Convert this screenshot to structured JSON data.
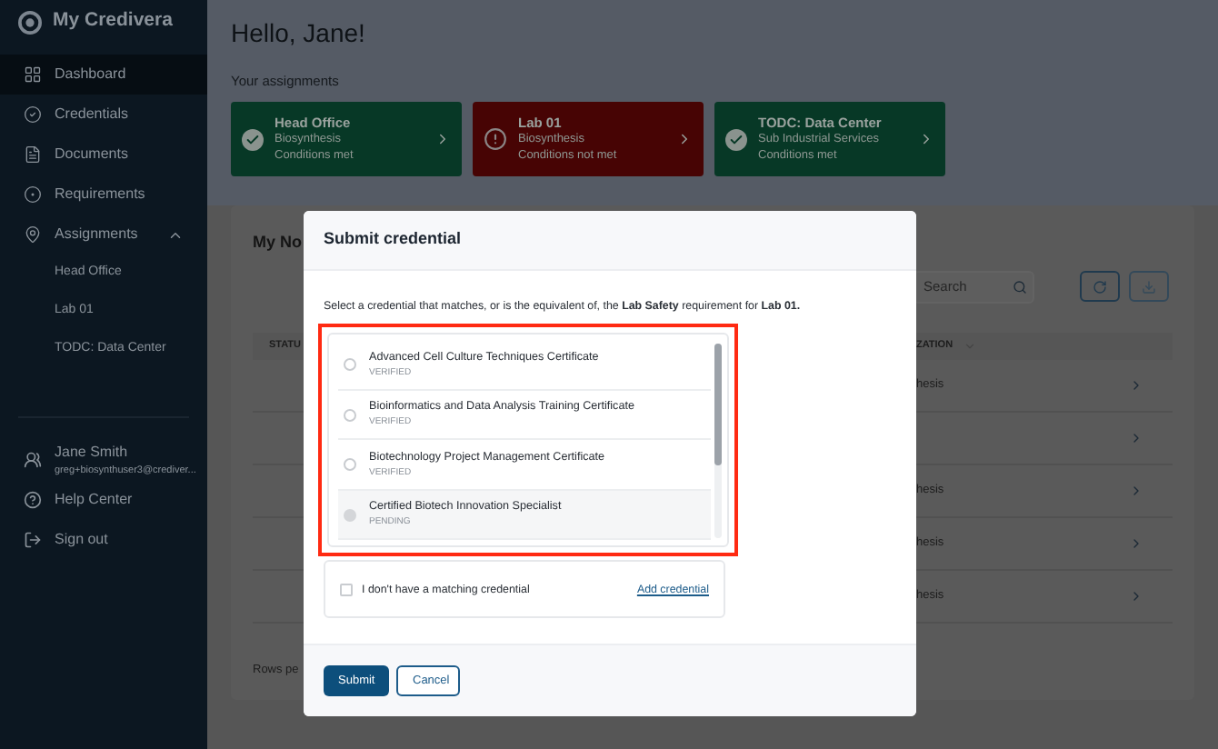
{
  "sidebar": {
    "brand": "My Credivera",
    "items": [
      {
        "label": "Dashboard",
        "selected": true
      },
      {
        "label": "Credentials",
        "selected": false
      },
      {
        "label": "Documents",
        "selected": false
      },
      {
        "label": "Requirements",
        "selected": false
      },
      {
        "label": "Assignments",
        "selected": false,
        "expanded": true,
        "children": [
          {
            "label": "Head Office"
          },
          {
            "label": "Lab 01"
          },
          {
            "label": "TODC: Data Center"
          }
        ]
      }
    ],
    "user": {
      "name": "Jane Smith",
      "email": "greg+biosynthuser3@crediver..."
    },
    "bottom_items": [
      {
        "label": "Help Center"
      },
      {
        "label": "Sign out"
      }
    ]
  },
  "main": {
    "greeting": "Hello, Jane!",
    "assignments_label": "Your assignments",
    "assignments": [
      {
        "title": "Head Office",
        "organization": "Biosynthesis",
        "status": "Conditions met",
        "met": true
      },
      {
        "title": "Lab 01",
        "organization": "Biosynthesis",
        "status": "Conditions not met",
        "met": false
      },
      {
        "title": "TODC: Data Center",
        "organization": "Sub Industrial Services",
        "status": "Conditions met",
        "met": true
      }
    ],
    "panel": {
      "title": "My No",
      "search": {
        "placeholder": "Search"
      },
      "columns": [
        "STATU",
        "ZATION"
      ],
      "rows": [
        {
          "organization": "hesis"
        },
        {},
        {
          "organization": "hesis"
        },
        {
          "organization": "hesis"
        },
        {
          "organization": "hesis"
        }
      ],
      "pagination": "Rows pe"
    }
  },
  "modal": {
    "title": "Submit credential",
    "instruction": "Select a credential that matches, or is the equivalent of, the **Lab Safety** requirement for **Lab 01.**",
    "outlined": true,
    "options": [
      {
        "name": "Advanced Cell Culture Techniques Certificate",
        "status": "VERIFIED",
        "selected": false,
        "disabled": false
      },
      {
        "name": "Bioinformatics and Data Analysis Training Certificate",
        "status": "VERIFIED",
        "selected": false,
        "disabled": false
      },
      {
        "name": "Biotechnology Project Management Certificate",
        "status": "VERIFIED",
        "selected": false,
        "disabled": false
      },
      {
        "name": "Certified Biotech Innovation Specialist",
        "status": "PENDING",
        "selected": false,
        "disabled": true
      }
    ],
    "no_match": {
      "label": "I don't have a matching credential",
      "checked": false
    },
    "add_link": "Add credential",
    "buttons": [
      {
        "label": "Submit",
        "kind": "primary"
      },
      {
        "label": "Cancel",
        "kind": "secondary"
      }
    ]
  }
}
